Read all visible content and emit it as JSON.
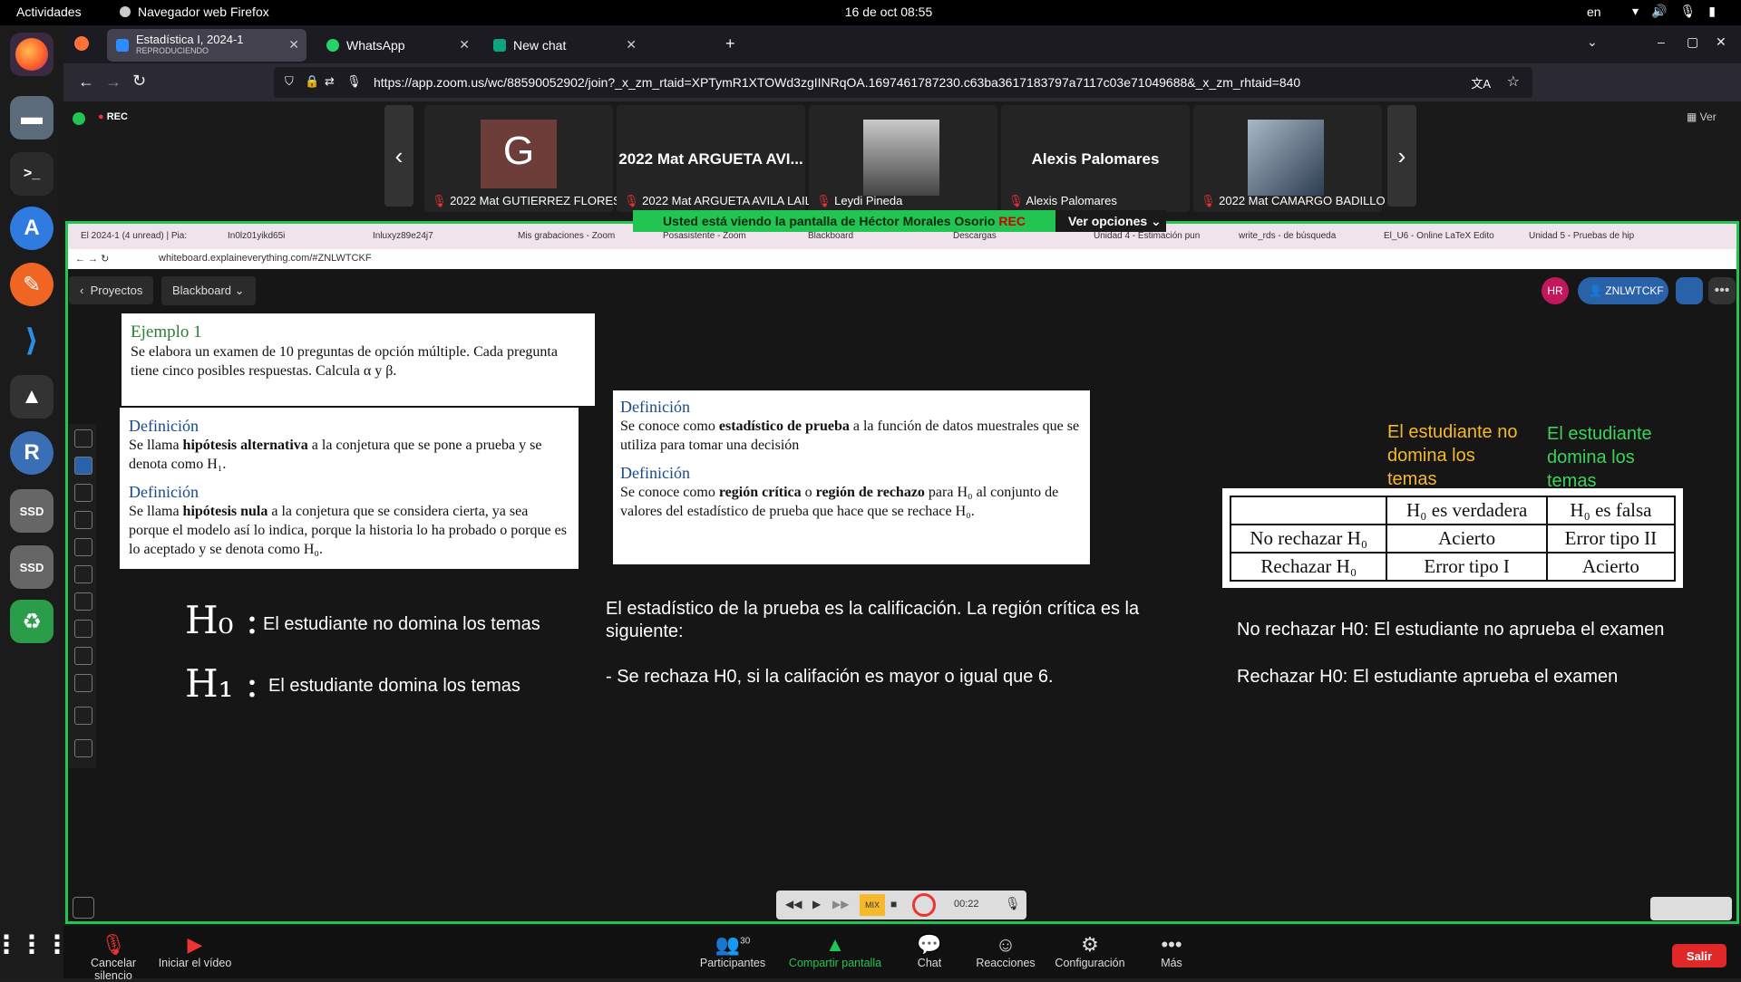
{
  "topbar": {
    "activities": "Actividades",
    "app_name": "Navegador web Firefox",
    "clock": "16 de oct  08:55",
    "lang": "en"
  },
  "browser": {
    "tabs": [
      {
        "title": "Estadística I, 2024-1",
        "subtitle": "REPRODUCIENDO",
        "icon": "zoom-icon"
      },
      {
        "title": "WhatsApp",
        "icon": "whatsapp-icon"
      },
      {
        "title": "New chat",
        "icon": "chatgpt-icon"
      }
    ],
    "url": "https://app.zoom.us/wc/88590052902/join?_x_zm_rtaid=XPTymR1XTOWd3zgIINRqOA.1697461787230.c63ba3617183797a7117c03e71049688&_x_zm_rhtaid=840"
  },
  "zoom": {
    "rec_badge": "REC",
    "view_label": "Ver",
    "participants": [
      {
        "avatar_letter": "G",
        "name": "2022 Mat GUTIERREZ FLORES ..."
      },
      {
        "big_name": "2022 Mat ARGUETA AVI...",
        "name": "2022 Mat ARGUETA AVILA LAIL..."
      },
      {
        "name": "Leydi Pineda"
      },
      {
        "big_name": "Alexis Palomares",
        "name": "Alexis Palomares"
      },
      {
        "name": "2022 Mat CAMARGO BADILLO ..."
      }
    ],
    "banner": "Usted está viendo la pantalla de  Héctor Morales Osorio",
    "banner_rec": "REC",
    "view_options": "Ver opciones",
    "bottom": {
      "mute": "Cancelar silencio",
      "video": "Iniciar el vídeo",
      "participants": "Participantes",
      "participants_count": "30",
      "share": "Compartir pantalla",
      "chat": "Chat",
      "reactions": "Reacciones",
      "settings": "Configuración",
      "more": "Más",
      "leave": "Salir"
    }
  },
  "inner_browser": {
    "tabs": [
      "El 2024-1 (4 unread) | Pia:",
      "In0lz01yikd65i",
      "Inluxyz89e24j7",
      "Mis grabaciones - Zoom",
      "Posasistente - Zoom",
      "Blackboard",
      "Descargas",
      "Unidad 4 - Estimación pun",
      "write_rds - de búsqueda",
      "El_U6 - Online LaTeX Edito",
      "Unidad 5 - Pruebas de hip"
    ],
    "url": "whiteboard.explaineverything.com/#ZNLWTCKF"
  },
  "whiteboard": {
    "crumb_back": "Proyectos",
    "crumb_board": "Blackboard",
    "user_initials": "HR",
    "board_code": "ZNLWTCKF",
    "timer": "00:22",
    "mix": "MIX",
    "ejemplo": {
      "title": "Ejemplo 1",
      "text": "Se elabora un examen de 10 preguntas de opción múltiple. Cada pregunta tiene cinco posibles respuestas. Calcula α y β."
    },
    "def_alt": {
      "title": "Definición",
      "pre": "Se llama ",
      "bold": "hipótesis alternativa",
      "post": " a la conjetura que se pone a prueba y se denota como H₁."
    },
    "def_null": {
      "title": "Definición",
      "pre": "Se llama ",
      "bold": "hipótesis nula",
      "post": " a la conjetura que se considera cierta, ya sea porque el modelo así lo indica, porque la historia lo ha probado o porque es lo aceptado y se denota como H₀."
    },
    "def_stat": {
      "title": "Definición",
      "pre": "Se conoce como ",
      "bold": "estadístico de prueba",
      "post": " a la función de datos muestrales que se utiliza para tomar una decisión"
    },
    "def_region": {
      "title": "Definición",
      "pre": "Se conoce como ",
      "bold1": "región crítica",
      "mid": " o ",
      "bold2": "región de rechazo",
      "post": " para H₀ al conjunto de valores del estadístico de prueba que hace que se rechace H₀."
    },
    "h0_label": "H₀ :",
    "h0_text": "El estudiante no domina los temas",
    "h1_label": "H₁ :",
    "h1_text": "El estudiante domina los temas",
    "stat_text": "El estadístico de la prueba es la calificación. La región crítica es la siguiente:",
    "reject_text": "- Se rechaza H0, si la califación es mayor o igual que 6.",
    "orange_note": "El estudiante no domina los temas",
    "green_note": "El estudiante domina los temas",
    "table": {
      "headers": [
        "",
        "H₀ es verdadera",
        "H₀ es falsa"
      ],
      "rows": [
        [
          "No rechazar H₀",
          "Acierto",
          "Error tipo II"
        ],
        [
          "Rechazar H₀",
          "Error tipo I",
          "Acierto"
        ]
      ]
    },
    "no_reject_note": "No rechazar H0: El estudiante no aprueba  el examen",
    "reject_note": "Rechazar H0: El estudiante aprueba el examen"
  },
  "colors": {
    "zoom_green": "#23c552",
    "firefox_dark": "#1c1b22",
    "leave_red": "#e02828"
  }
}
